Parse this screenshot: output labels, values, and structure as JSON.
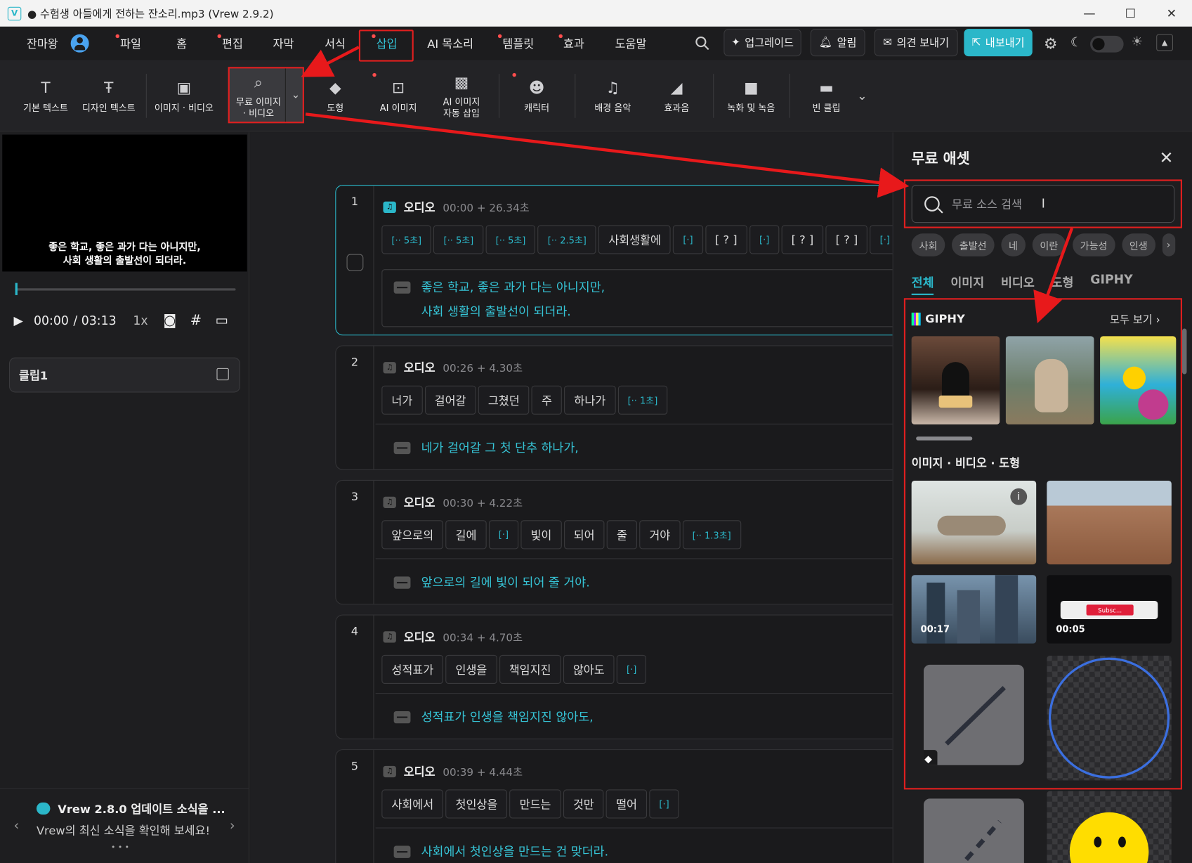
{
  "window": {
    "title": "● 수험생 아들에게 전하는 잔소리.mp3 (Vrew 2.9.2)",
    "logo_text": "V",
    "min": "—",
    "max": "☐",
    "close": "✕"
  },
  "menu": {
    "user": "잔마왕",
    "items": [
      "파일",
      "홈",
      "편집",
      "자막",
      "서식",
      "삽입",
      "AI 목소리",
      "템플릿",
      "효과",
      "도움말"
    ],
    "upgrade": "업그레이드",
    "alerts": "알림",
    "feedback": "의견 보내기",
    "export": "내보내기"
  },
  "toolbar": {
    "tools": [
      "기본 텍스트",
      "디자인 텍스트",
      "이미지 · 비디오",
      "무료 이미지\n· 비디오",
      "도형",
      "AI 이미지",
      "AI 이미지\n자동 삽입",
      "캐릭터",
      "배경 음악",
      "효과음",
      "녹화 및 녹음",
      "빈 클립"
    ]
  },
  "preview": {
    "subtitle_line1": "좋은 학교, 좋은 과가 다는 아니지만,",
    "subtitle_line2": "사회 생활의 출발선이 되더라.",
    "time_current": "00:00",
    "time_total": "/ 03:13",
    "speed": "1x",
    "clip_name": "클립1"
  },
  "news": {
    "title": "Vrew 2.8.0 업데이트 소식을 ...",
    "subtitle": "Vrew의 최신 소식을 확인해 보세요!",
    "dots": "• • •",
    "prev": "‹",
    "next": "›"
  },
  "clips": [
    {
      "num": "1",
      "audio": "오디오",
      "time": "00:00 + 26.34초",
      "words": [
        "[·· 5초]",
        "[·· 5초]",
        "[·· 5초]",
        "[·· 2.5초]",
        "사회생활에",
        "[·]",
        "[ ? ]",
        "[·]",
        "[ ? ]",
        "[ ? ]",
        "[·]"
      ],
      "subtitle_line1": "좋은 학교, 좋은 과가 다는 아니지만,",
      "subtitle_line2": "사회 생활의 출발선이 되더라."
    },
    {
      "num": "2",
      "audio": "오디오",
      "time": "00:26 + 4.30초",
      "words": [
        "너가",
        "걸어갈",
        "그쳤던",
        "주",
        "하나가",
        "[·· 1초]"
      ],
      "subtitle_line1": "네가 걸어갈 그 첫 단추 하나가,"
    },
    {
      "num": "3",
      "audio": "오디오",
      "time": "00:30 + 4.22초",
      "words": [
        "앞으로의",
        "길에",
        "[·]",
        "빛이",
        "되어",
        "줄",
        "거야",
        "[·· 1.3초]"
      ],
      "subtitle_line1": "앞으로의 길에 빛이 되어 줄 거야."
    },
    {
      "num": "4",
      "audio": "오디오",
      "time": "00:34 + 4.70초",
      "words": [
        "성적표가",
        "인생을",
        "책임지진",
        "않아도",
        "[·]"
      ],
      "subtitle_line1": "성적표가 인생을 책임지진 않아도,"
    },
    {
      "num": "5",
      "audio": "오디오",
      "time": "00:39 + 4.44초",
      "words": [
        "사회에서",
        "첫인상을",
        "만드는",
        "것만",
        "떨어",
        "[·]"
      ],
      "subtitle_line1": "사회에서 첫인상을 만드는 건 맞더라."
    }
  ],
  "assets_panel": {
    "title": "무료 애셋",
    "search_placeholder": "무료 소스 검색",
    "chips": [
      "사회",
      "출발선",
      "네",
      "이란",
      "가능성",
      "인생"
    ],
    "tabs": [
      "전체",
      "이미지",
      "비디오",
      "도형",
      "GIPHY"
    ],
    "giphy_title": "GIPHY",
    "see_all": "모두 보기",
    "section2_title": "이미지 · 비디오 · 도형",
    "video_durations": [
      "00:17",
      "00:05"
    ],
    "subscribe_text": "Subsc..."
  },
  "colors": {
    "accent": "#2bb7c9",
    "annotation_red": "#e01f1f"
  }
}
